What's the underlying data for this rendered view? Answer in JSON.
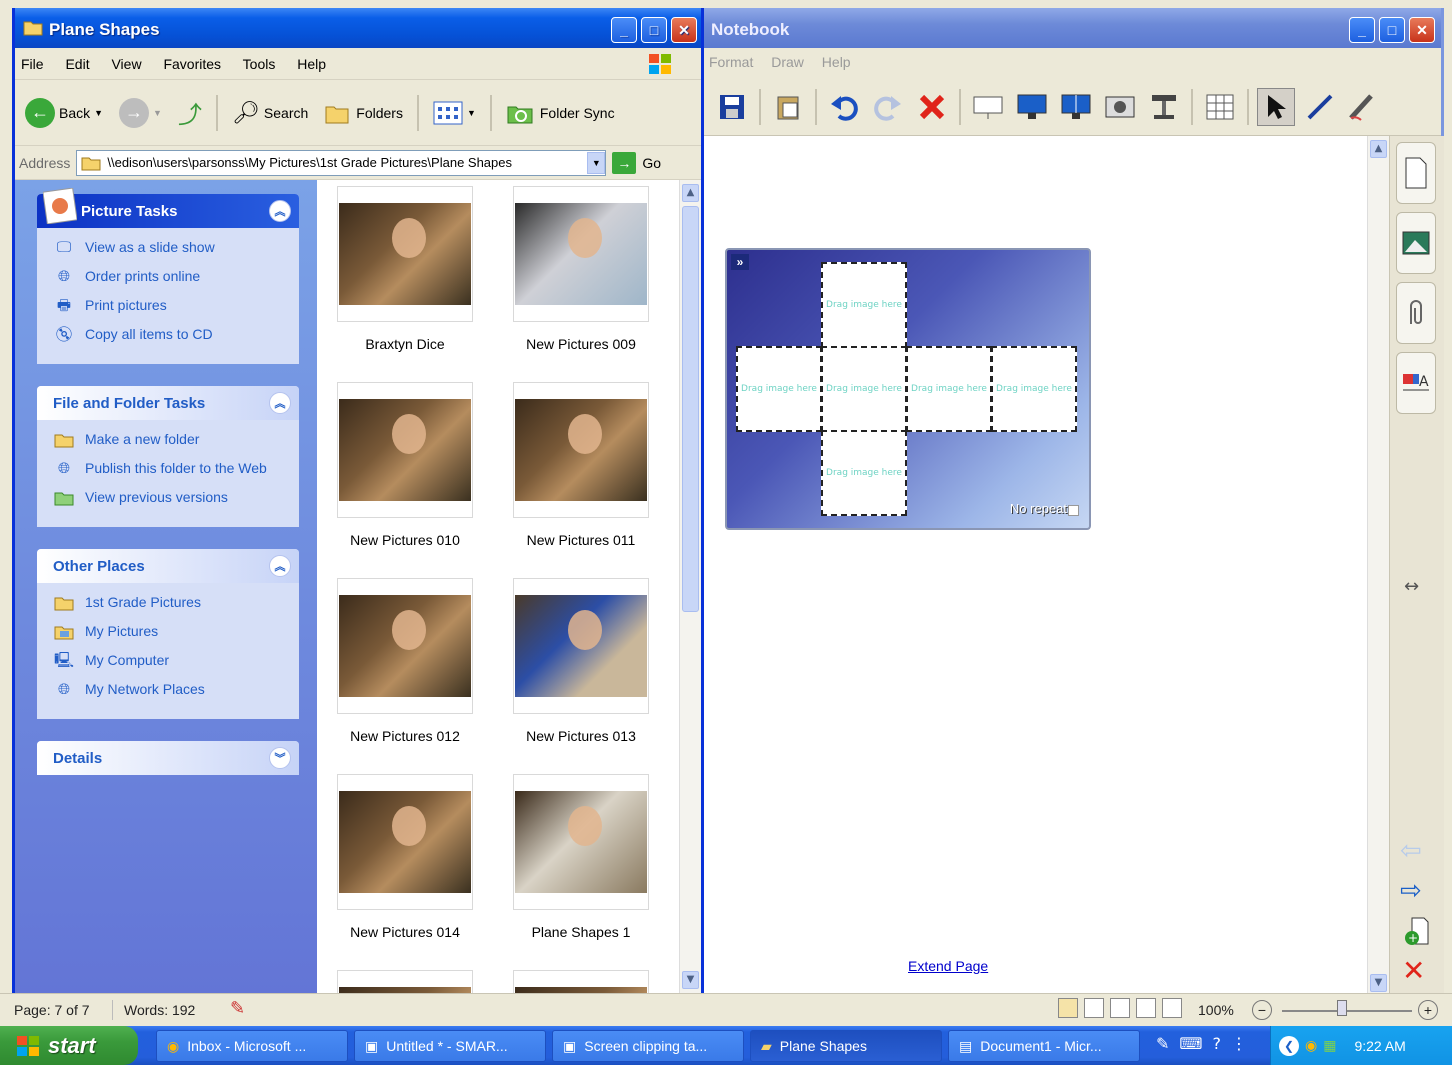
{
  "explorer": {
    "title": "Plane Shapes",
    "menu": [
      "File",
      "Edit",
      "View",
      "Favorites",
      "Tools",
      "Help"
    ],
    "toolbar": {
      "back": "Back",
      "search": "Search",
      "folders": "Folders",
      "folder_sync": "Folder Sync"
    },
    "address": {
      "label": "Address",
      "path": "\\\\edison\\users\\parsonss\\My Pictures\\1st Grade Pictures\\Plane Shapes",
      "go": "Go"
    },
    "panels": {
      "picture_tasks": {
        "title": "Picture Tasks",
        "items": [
          "View as a slide show",
          "Order prints online",
          "Print pictures",
          "Copy all items to CD"
        ]
      },
      "file_folder_tasks": {
        "title": "File and Folder Tasks",
        "items": [
          "Make a new folder",
          "Publish this folder to the Web",
          "View previous versions"
        ]
      },
      "other_places": {
        "title": "Other Places",
        "items": [
          "1st Grade Pictures",
          "My Pictures",
          "My Computer",
          "My Network Places"
        ]
      },
      "details": {
        "title": "Details"
      }
    },
    "thumbnails": [
      "Braxtyn Dice",
      "New Pictures 009",
      "New Pictures 010",
      "New Pictures 011",
      "New Pictures 012",
      "New Pictures 013",
      "New Pictures 014",
      "Plane Shapes 1"
    ]
  },
  "notebook": {
    "title": "Notebook",
    "menu": [
      "Format",
      "Draw",
      "Help"
    ],
    "cube": {
      "cell_text": "Drag image here",
      "no_repeat": "No repeat"
    },
    "extend_page": "Extend Page"
  },
  "word_status": {
    "page": "Page: 7 of 7",
    "words": "Words: 192",
    "zoom": "100%"
  },
  "taskbar": {
    "start": "start",
    "buttons": [
      "Inbox - Microsoft ...",
      "Untitled * - SMAR...",
      "Screen clipping ta...",
      "Plane Shapes",
      "Document1 - Micr..."
    ],
    "clock": "9:22 AM"
  },
  "colors": {
    "xp_blue": "#0831d9",
    "task_link": "#215dc6",
    "taskbar": "#245edb",
    "start_green": "#3a9a3b"
  }
}
